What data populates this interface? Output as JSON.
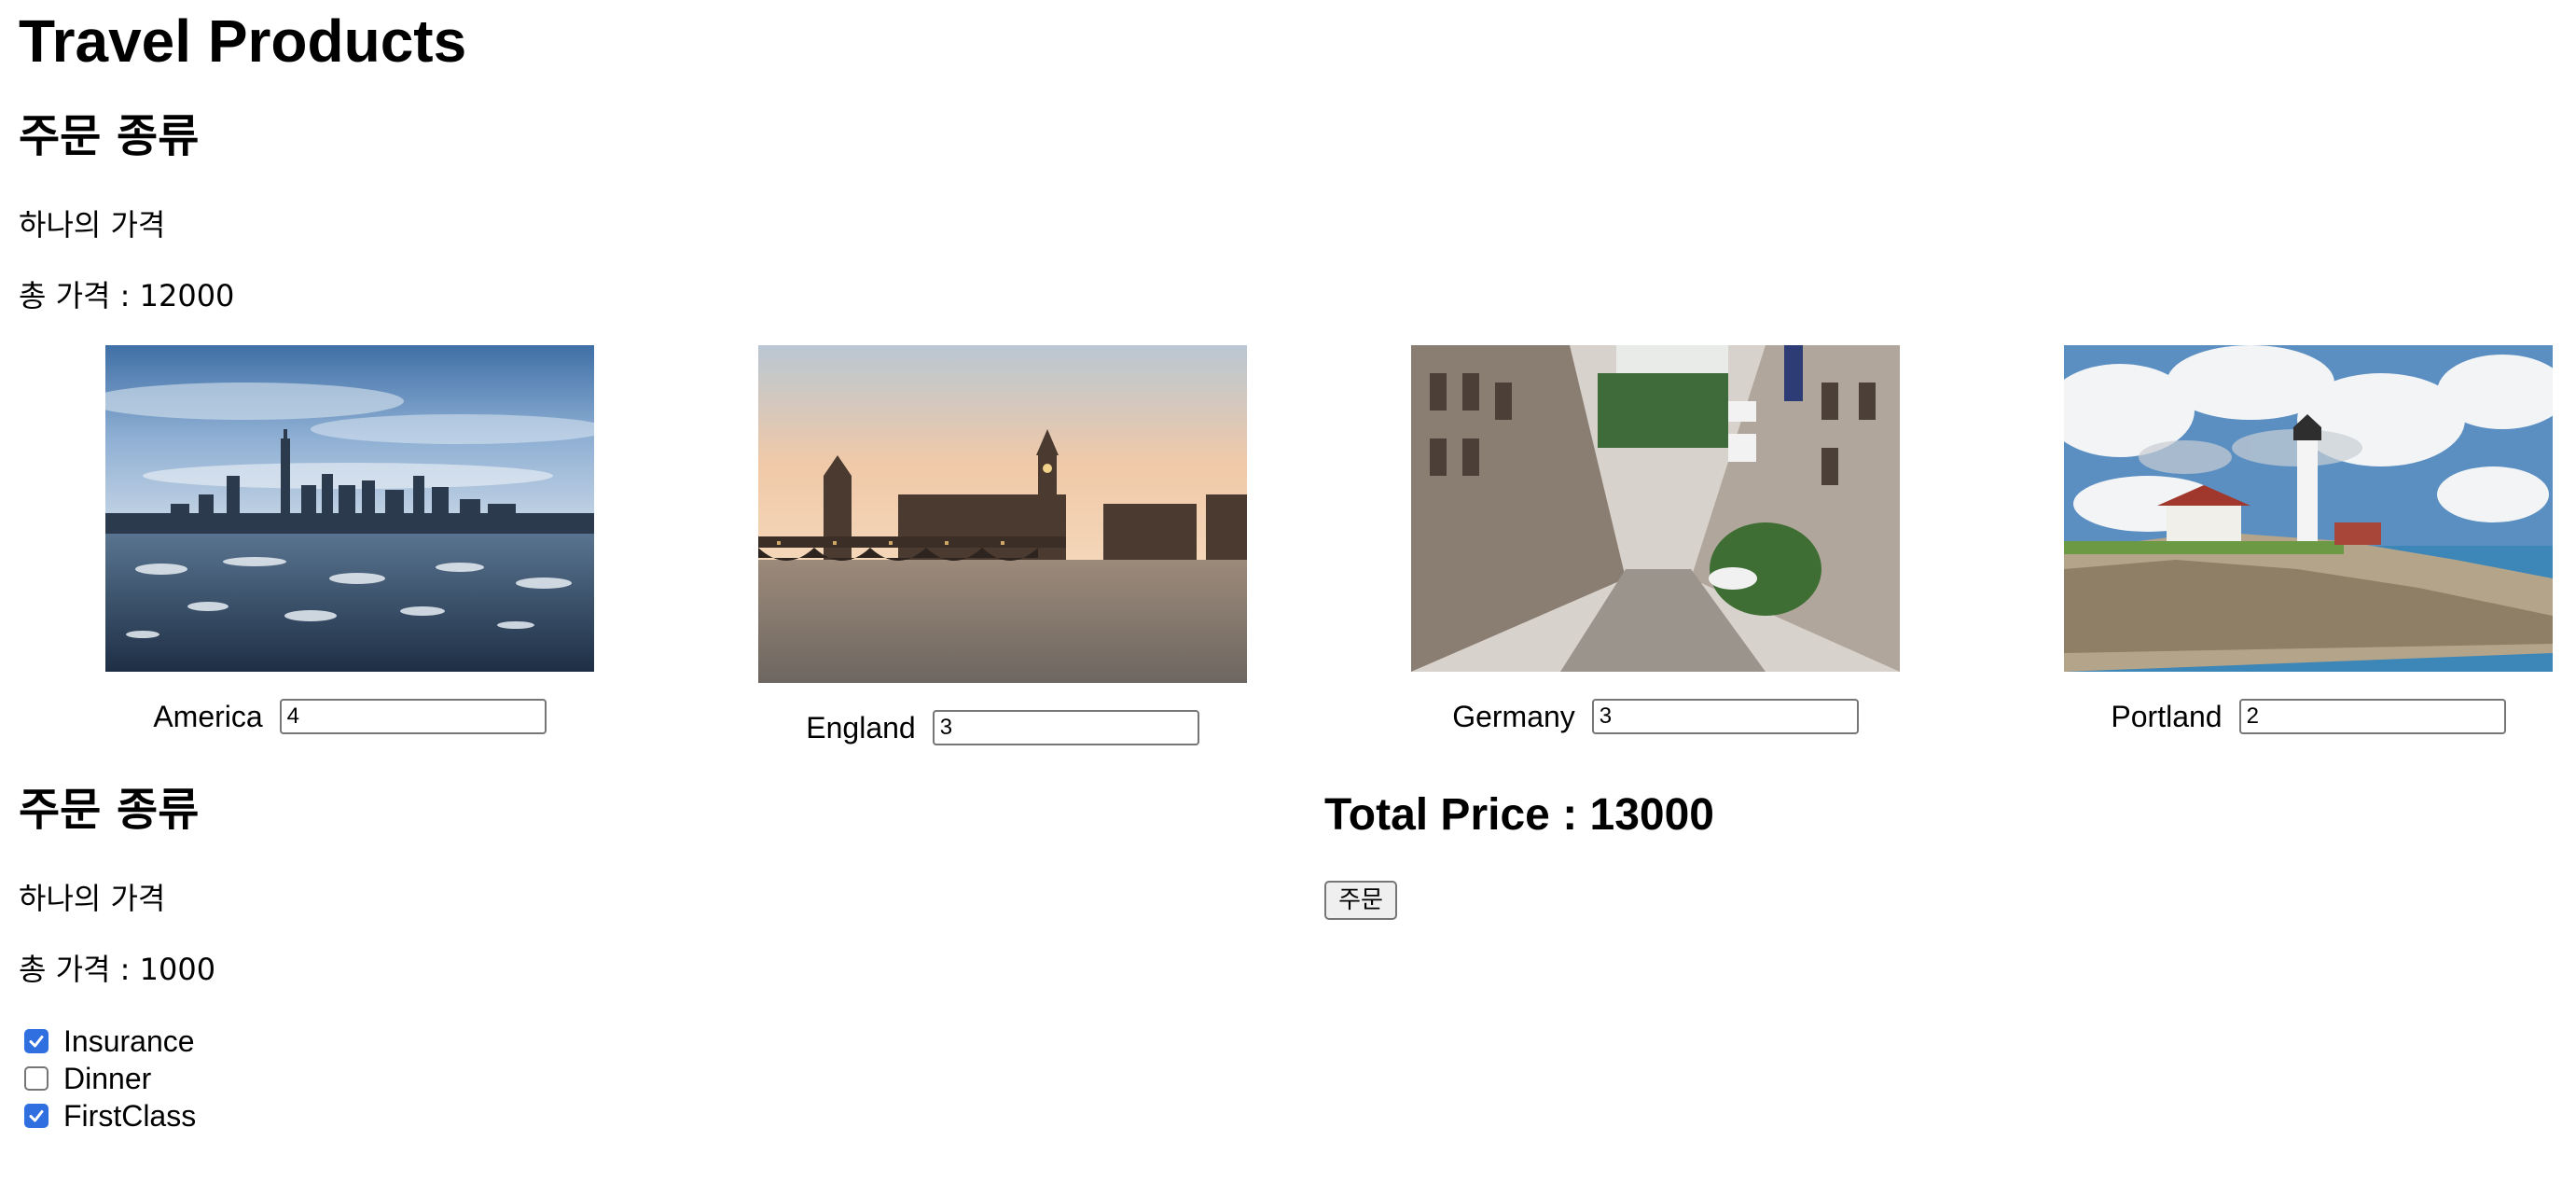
{
  "page": {
    "title": "Travel Products"
  },
  "order_section_1": {
    "heading": "주문 종류",
    "unit_price_label": "하나의 가격",
    "total_label": "총 가격 : 12000"
  },
  "products": [
    {
      "name": "America",
      "quantity": "4",
      "image": "new-york-skyline-photo"
    },
    {
      "name": "England",
      "quantity": "3",
      "image": "london-big-ben-photo"
    },
    {
      "name": "Germany",
      "quantity": "3",
      "image": "german-street-photo"
    },
    {
      "name": "Portland",
      "quantity": "2",
      "image": "portland-lighthouse-photo"
    }
  ],
  "order_section_2": {
    "heading": "주문 종류",
    "unit_price_label": "하나의 가격",
    "total_label": "총 가격 : 1000"
  },
  "options": [
    {
      "label": "Insurance",
      "checked": true
    },
    {
      "label": "Dinner",
      "checked": false
    },
    {
      "label": "FirstClass",
      "checked": true
    }
  ],
  "summary": {
    "total_price_text": "Total Price : 13000",
    "order_button_label": "주문"
  },
  "colors": {
    "checkbox_checked": "#2f6fe0",
    "input_border": "#767676",
    "button_bg": "#efefef"
  }
}
